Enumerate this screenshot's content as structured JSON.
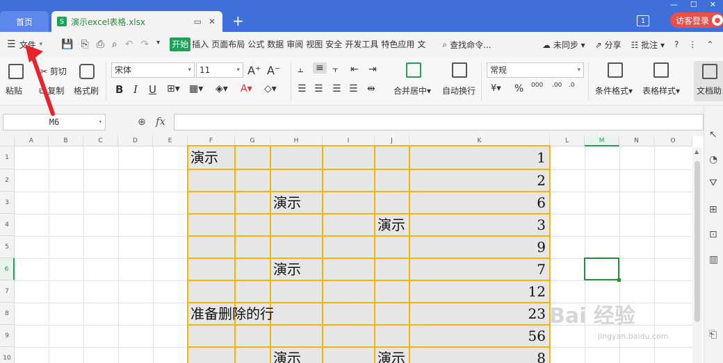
{
  "titlebar": {
    "home_tab": "首页",
    "file_tab": "演示excel表格.xlsx",
    "badge": "1",
    "login": "访客登录"
  },
  "menubar": {
    "file_menu": "文件",
    "menus": [
      "开始",
      "插入",
      "页面布局",
      "公式",
      "数据",
      "审阅",
      "视图",
      "安全",
      "开发工具",
      "特色应用",
      "文"
    ],
    "active_menu": "开始",
    "search": "查找命令...",
    "sync": "未同步",
    "share": "分享",
    "comment": "批注"
  },
  "ribbon": {
    "paste": "粘贴",
    "cut": "剪切",
    "copy": "复制",
    "format_painter": "格式刷",
    "font_name": "宋体",
    "font_size": "11",
    "bold": "B",
    "italic": "I",
    "underline": "U",
    "merge_center": "合并居中",
    "wrap_text": "自动换行",
    "number_format": "常规",
    "percent": "%",
    "cond_format": "条件格式",
    "table_style": "表格样式",
    "doc_helper": "文档助"
  },
  "formula_bar": {
    "name_box": "M6",
    "fx": "fx",
    "formula": ""
  },
  "grid": {
    "columns": [
      "A",
      "B",
      "C",
      "D",
      "E",
      "F",
      "G",
      "H",
      "I",
      "J",
      "K",
      "L",
      "M",
      "N",
      "O"
    ],
    "rows": [
      "1",
      "2",
      "3",
      "4",
      "5",
      "6",
      "7",
      "8",
      "9",
      "10"
    ],
    "text_cells": [
      {
        "col": "F",
        "row": "1",
        "text": "演示"
      },
      {
        "col": "H",
        "row": "3",
        "text": "演示"
      },
      {
        "col": "J",
        "row": "4",
        "text": "演示"
      },
      {
        "col": "H",
        "row": "6",
        "text": "演示"
      },
      {
        "col": "F",
        "row": "8",
        "text": "准备删除的行"
      },
      {
        "col": "H",
        "row": "10",
        "text": "演示"
      },
      {
        "col": "J",
        "row": "10",
        "text": "演示"
      }
    ],
    "k_values": [
      "1",
      "2",
      "6",
      "3",
      "9",
      "7",
      "12",
      "23",
      "56",
      "8"
    ],
    "selected": "M6"
  },
  "colors": {
    "titlebar": "#3f6fd8",
    "table_border": "#f7b500",
    "table_fill": "#e6e6e6",
    "accent": "#1ea05a",
    "arrow": "#e8232c"
  },
  "watermark": {
    "main": "Bai 经验",
    "sub": "jingyan.baidu.com"
  }
}
